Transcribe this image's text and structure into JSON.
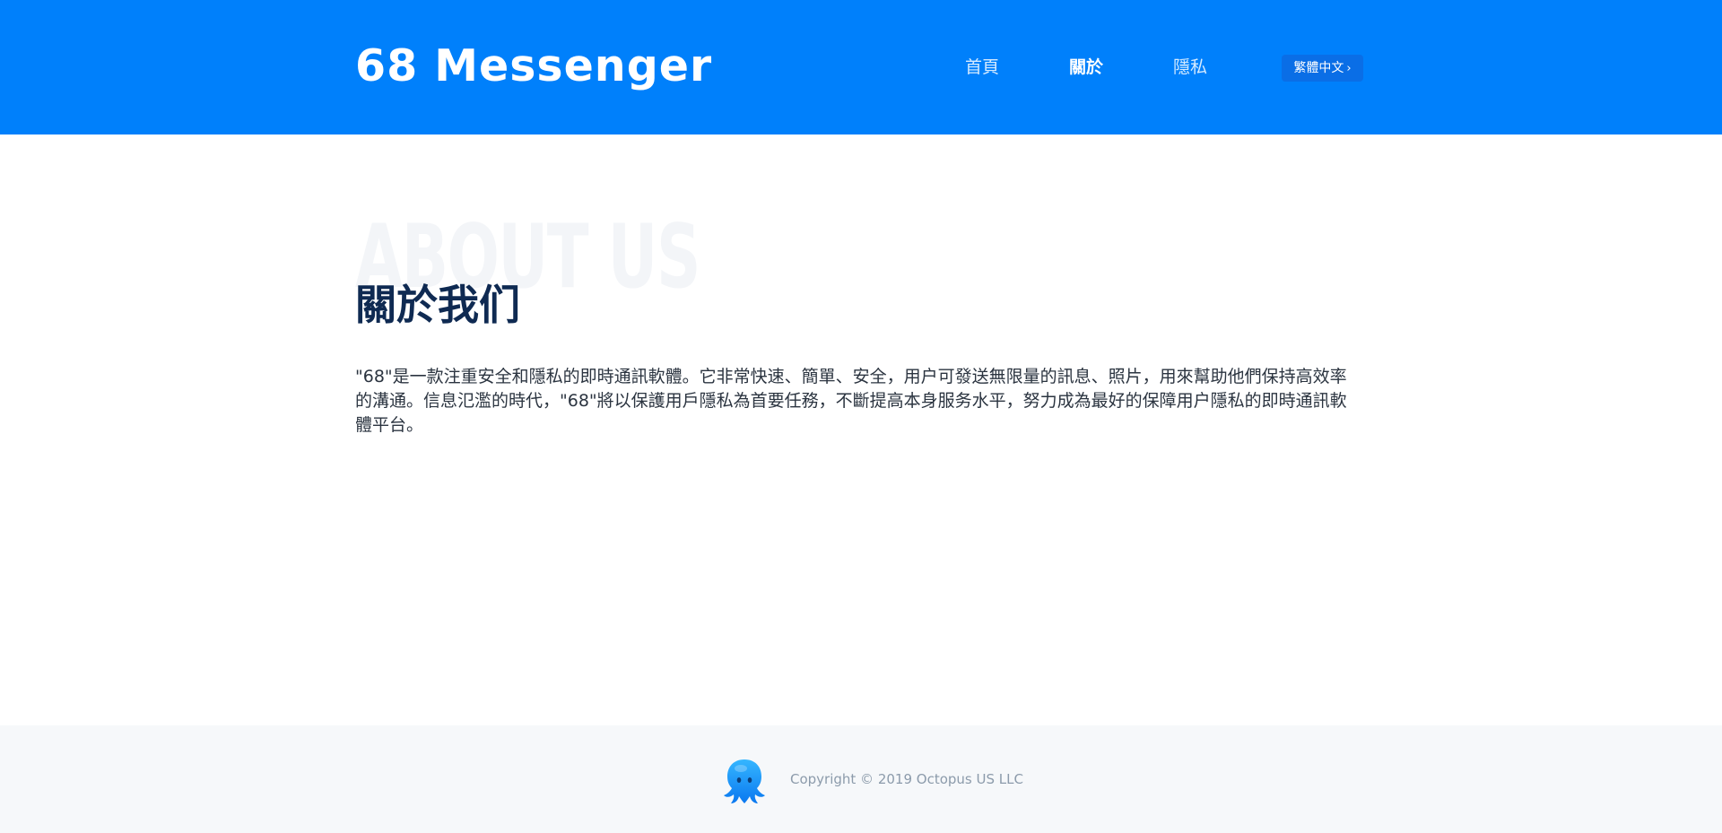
{
  "header": {
    "logo_text": "68 Messenger",
    "nav": [
      {
        "label": "首頁",
        "active": false
      },
      {
        "label": "關於",
        "active": true
      },
      {
        "label": "隱私",
        "active": false
      }
    ],
    "language_button": "繁體中文",
    "language_icon": "chevron-right-icon",
    "background_color": "#0080fb"
  },
  "main": {
    "ghost_title": "ABOUT US",
    "title": "關於我们",
    "paragraph": "\"68\"是一款注重安全和隱私的即時通訊軟體。它非常快速、簡單、安全，用户可發送無限量的訊息、照片，用來幫助他們保持高效率的溝通。信息氾濫的時代，\"68\"將以保護用戶隱私為首要任務，不斷提高本身服务水平，努力成為最好的保障用户隱私的即時通訊軟體平台。"
  },
  "footer": {
    "mascot_icon": "octopus-icon",
    "copyright": "Copyright © 2019 Octopus US LLC"
  }
}
